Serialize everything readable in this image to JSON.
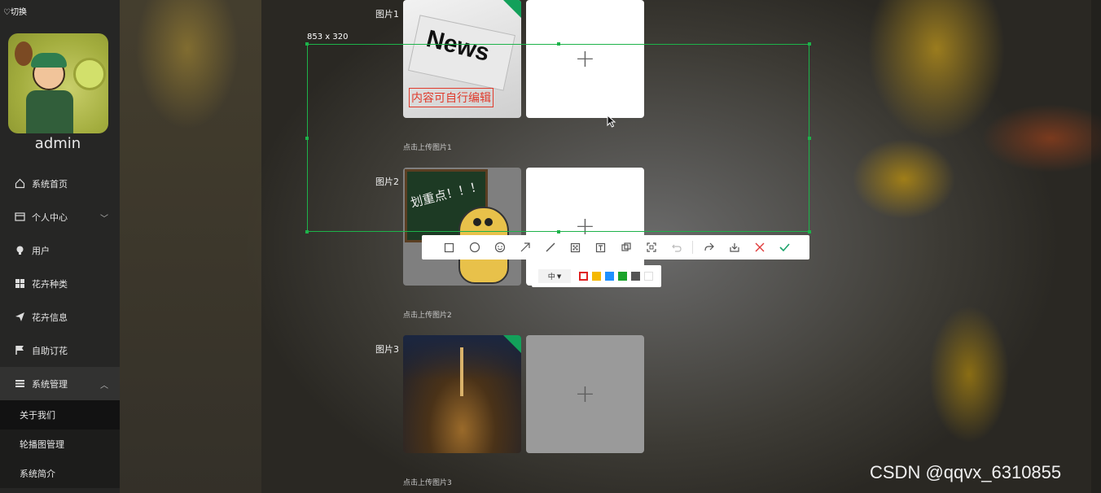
{
  "sidebar": {
    "switch_label": "♡切换",
    "username": "admin",
    "items": [
      {
        "label": "系统首页",
        "icon": "home-icon"
      },
      {
        "label": "个人中心",
        "icon": "card-icon"
      },
      {
        "label": "用户",
        "icon": "bulb-icon"
      },
      {
        "label": "花卉种类",
        "icon": "grid-icon"
      },
      {
        "label": "花卉信息",
        "icon": "send-icon"
      },
      {
        "label": "自助订花",
        "icon": "flag-icon"
      },
      {
        "label": "系统管理",
        "icon": "menu-icon"
      }
    ],
    "sub_items": [
      "关于我们",
      "轮播图管理",
      "系统简介"
    ]
  },
  "form": {
    "pic1_label": "图片1",
    "pic2_label": "图片2",
    "pic3_label": "图片3",
    "hint1": "点击上传图片1",
    "hint2": "点击上传图片2",
    "hint3": "点击上传图片3",
    "news_word": "News",
    "news_caption": "内容可自行编辑",
    "board_text": "划重点！！！",
    "plus": "+"
  },
  "capture": {
    "size_label": "853 x 320",
    "toolbar_icons": [
      "rect-icon",
      "circle-icon",
      "emoji-icon",
      "arrow-icon",
      "line-icon",
      "mosaic-icon",
      "text-icon",
      "layers-icon",
      "ocr-icon",
      "undo-icon",
      "share-icon",
      "save-icon",
      "cancel-icon",
      "confirm-icon"
    ],
    "size_option": "中",
    "colors": [
      "#ffffff",
      "#f5b800",
      "#1e90ff",
      "#1aa32a",
      "#555555",
      "#ffffff"
    ],
    "accent": "#1db34a"
  },
  "watermark": "CSDN @qqvx_6310855"
}
